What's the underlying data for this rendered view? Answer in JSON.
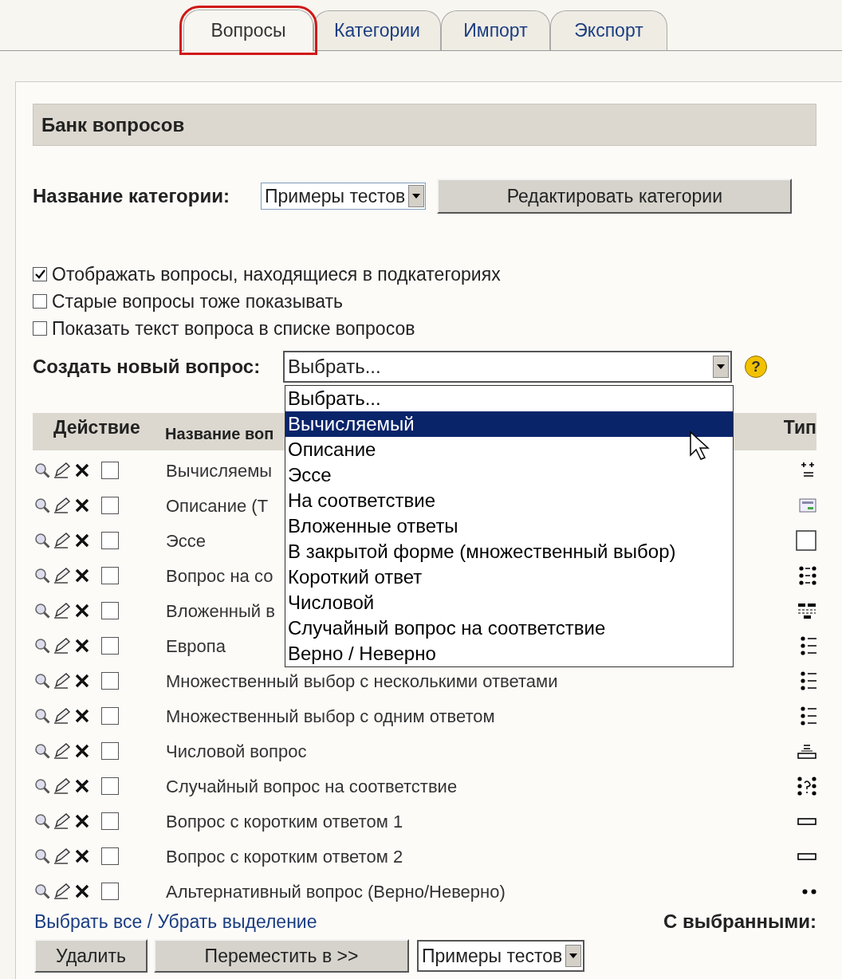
{
  "tabs": [
    {
      "label": "Вопросы",
      "selected": true
    },
    {
      "label": "Категории",
      "selected": false
    },
    {
      "label": "Импорт",
      "selected": false
    },
    {
      "label": "Экспорт",
      "selected": false
    }
  ],
  "bank": {
    "title": "Банк вопросов",
    "category_label": "Название категории:",
    "category_value": "Примеры тестов",
    "edit_button": "Редактировать категории",
    "options": [
      {
        "label": "Отображать вопросы, находящиеся в подкатегориях",
        "checked": true
      },
      {
        "label": "Старые вопросы тоже показывать",
        "checked": false
      },
      {
        "label": "Показать текст вопроса в списке вопросов",
        "checked": false
      }
    ],
    "create_label": "Создать новый вопрос:",
    "create_value": "Выбрать...",
    "help_glyph": "?",
    "create_menu": [
      {
        "label": "Выбрать...",
        "selected": false
      },
      {
        "label": "Вычисляемый",
        "selected": true
      },
      {
        "label": "Описание",
        "selected": false
      },
      {
        "label": "Эссе",
        "selected": false
      },
      {
        "label": "На соответствие",
        "selected": false
      },
      {
        "label": "Вложенные ответы",
        "selected": false
      },
      {
        "label": "В закрытой форме (множественный выбор)",
        "selected": false
      },
      {
        "label": "Короткий ответ",
        "selected": false
      },
      {
        "label": "Числовой",
        "selected": false
      },
      {
        "label": "Случайный вопрос на соответствие",
        "selected": false
      },
      {
        "label": "Верно / Неверно",
        "selected": false
      }
    ]
  },
  "table": {
    "columns": [
      "Действие",
      "Название воп",
      "Тип"
    ],
    "rows": [
      {
        "name": "Вычисляемы",
        "kind": "calculated",
        "checked": false
      },
      {
        "name": "Описание (Т",
        "kind": "description",
        "checked": false
      },
      {
        "name": "Эссе",
        "kind": "essay",
        "checked": false
      },
      {
        "name": "Вопрос на со",
        "kind": "match",
        "checked": false
      },
      {
        "name": "Вложенный в",
        "kind": "multianswer",
        "checked": false
      },
      {
        "name": "Европа",
        "kind": "multichoice",
        "checked": false
      },
      {
        "name": "Множественный выбор с несколькими ответами",
        "kind": "multichoice",
        "checked": false
      },
      {
        "name": "Множественный выбор с одним ответом",
        "kind": "multichoice",
        "checked": false
      },
      {
        "name": "Числовой вопрос",
        "kind": "numerical",
        "checked": false
      },
      {
        "name": "Случайный вопрос на соответствие",
        "kind": "randommatch",
        "checked": false
      },
      {
        "name": "Вопрос с коротким ответом 1",
        "kind": "shortanswer",
        "checked": false
      },
      {
        "name": "Вопрос с коротким ответом 2",
        "kind": "shortanswer",
        "checked": false
      },
      {
        "name": "Альтернативный вопрос (Верно/Неверно)",
        "kind": "truefalse",
        "checked": false
      }
    ]
  },
  "footer": {
    "select_link": "Выбрать все / Убрать выделение",
    "with_selected": "С выбранными:",
    "delete_button": "Удалить",
    "move_button": "Переместить в >>",
    "target_value": "Примеры тестов"
  }
}
